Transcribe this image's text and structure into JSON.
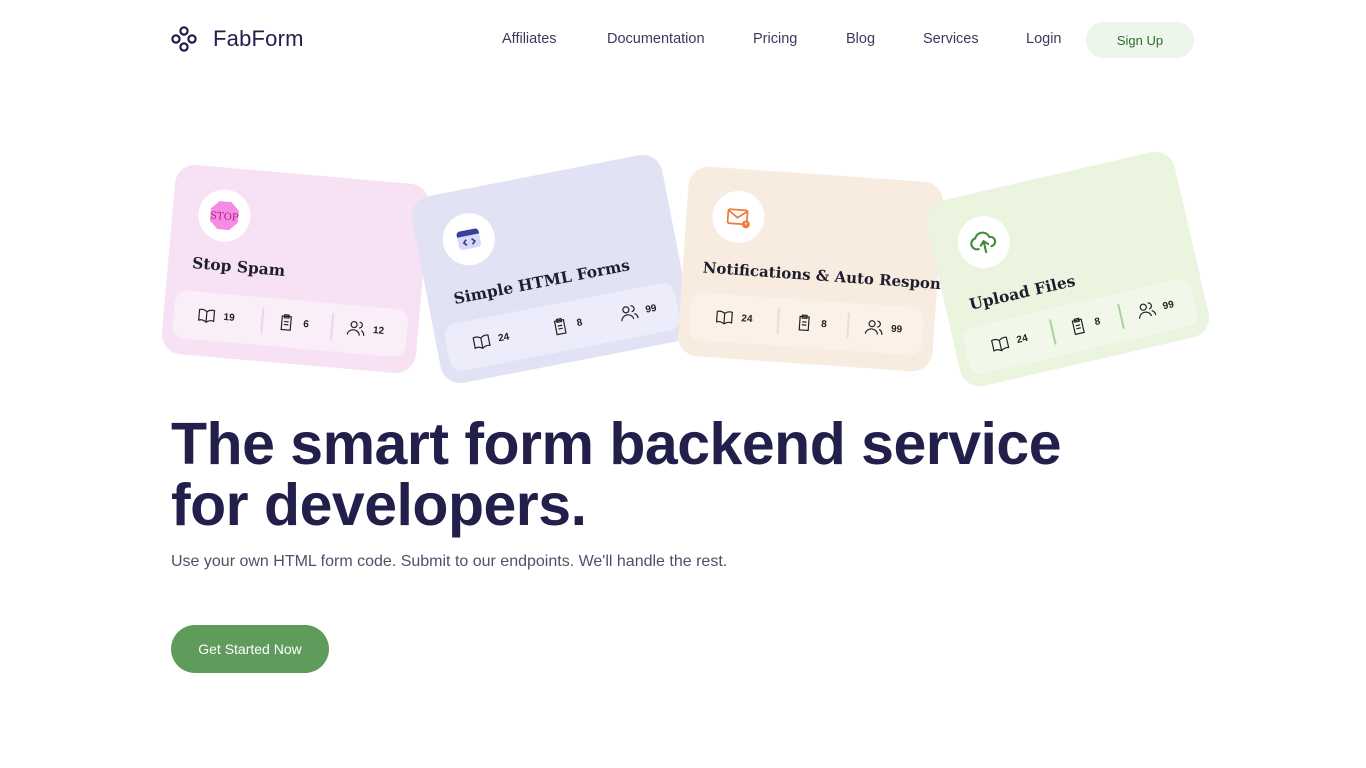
{
  "header": {
    "brand": "FabForm",
    "nav": [
      "Affiliates",
      "Documentation",
      "Pricing",
      "Blog",
      "Services",
      "Login"
    ],
    "signup_label": "Sign Up"
  },
  "cards": [
    {
      "title": "Stop Spam",
      "icon": "stop-sign-icon",
      "icon_text": "STOP",
      "stats": [
        "19",
        "6",
        "12"
      ],
      "color": "#f6e2f4"
    },
    {
      "title": "Simple HTML Forms",
      "icon": "code-browser-icon",
      "stats": [
        "24",
        "8",
        "99"
      ],
      "color": "#e2e2f5"
    },
    {
      "title": "Notifications & Auto Responses",
      "icon": "mail-notification-icon",
      "stats": [
        "24",
        "8",
        "99"
      ],
      "color": "#f8ebdf"
    },
    {
      "title": "Upload Files",
      "icon": "cloud-upload-icon",
      "stats": [
        "24",
        "8",
        "99"
      ],
      "color": "#eaf4df"
    }
  ],
  "hero": {
    "headline_line1": "The smart form backend service",
    "headline_line2": "for developers.",
    "subtitle": "Use your own HTML form code. Submit to our endpoints. We'll handle the rest.",
    "cta_label": "Get Started Now"
  },
  "colors": {
    "accent": "#5f9b5b",
    "heading": "#22204a",
    "signup_bg": "#edf6ea"
  }
}
